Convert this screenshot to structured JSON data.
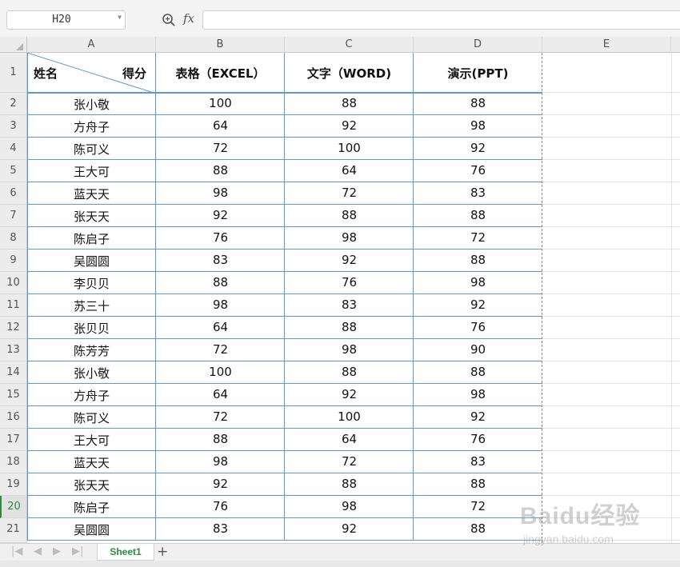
{
  "formula_bar": {
    "name_box": "H20",
    "fx_label": "fx",
    "formula_value": ""
  },
  "columns": [
    "A",
    "B",
    "C",
    "D",
    "E"
  ],
  "rows": [
    "1",
    "2",
    "3",
    "4",
    "5",
    "6",
    "7",
    "8",
    "9",
    "10",
    "11",
    "12",
    "13",
    "14",
    "15",
    "16",
    "17",
    "18",
    "19",
    "20",
    "21"
  ],
  "active_row": "20",
  "table": {
    "header_name": "姓名",
    "header_score": "得分",
    "headers": [
      "表格（EXCEL）",
      "文字（WORD)",
      "演示(PPT)"
    ],
    "data": [
      [
        "张小敬",
        "100",
        "88",
        "88"
      ],
      [
        "方舟子",
        "64",
        "92",
        "98"
      ],
      [
        "陈可义",
        "72",
        "100",
        "92"
      ],
      [
        "王大可",
        "88",
        "64",
        "76"
      ],
      [
        "蓝天天",
        "98",
        "72",
        "83"
      ],
      [
        "张天天",
        "92",
        "88",
        "88"
      ],
      [
        "陈启子",
        "76",
        "98",
        "72"
      ],
      [
        "吴圆圆",
        "83",
        "92",
        "88"
      ],
      [
        "李贝贝",
        "88",
        "76",
        "98"
      ],
      [
        "苏三十",
        "98",
        "83",
        "92"
      ],
      [
        "张贝贝",
        "64",
        "88",
        "76"
      ],
      [
        "陈芳芳",
        "72",
        "98",
        "90"
      ],
      [
        "张小敬",
        "100",
        "88",
        "88"
      ],
      [
        "方舟子",
        "64",
        "92",
        "98"
      ],
      [
        "陈可义",
        "72",
        "100",
        "92"
      ],
      [
        "王大可",
        "88",
        "64",
        "76"
      ],
      [
        "蓝天天",
        "98",
        "72",
        "83"
      ],
      [
        "张天天",
        "92",
        "88",
        "88"
      ],
      [
        "陈启子",
        "76",
        "98",
        "72"
      ],
      [
        "吴圆圆",
        "83",
        "92",
        "88"
      ]
    ]
  },
  "sheet_tabs": [
    "Sheet1"
  ],
  "active_sheet": "Sheet1",
  "add_sheet_label": "+",
  "watermark": {
    "logo": "Baidu经验",
    "url": "jingyan.baidu.com"
  },
  "colors": {
    "table_border": "#5b9bd5",
    "active_accent": "#2a8c3c",
    "grid_line": "#e3e3e3"
  }
}
